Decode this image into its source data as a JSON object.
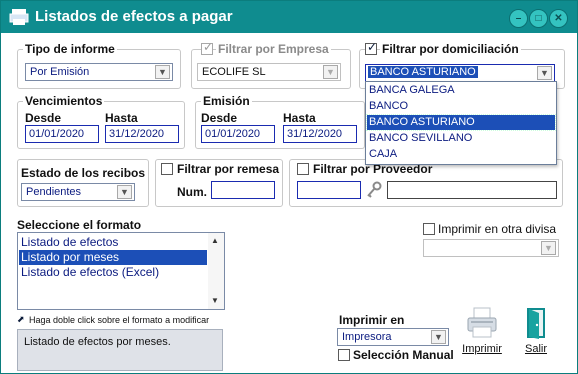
{
  "window": {
    "title": "Listados de efectos a pagar",
    "controls": [
      "minimize",
      "maximize",
      "close"
    ]
  },
  "tipo_informe": {
    "label": "Tipo de informe",
    "value": "Por Emisión"
  },
  "filtrar_empresa": {
    "label": "Filtrar por Empresa",
    "checked": true,
    "enabled": false,
    "value": "ECOLIFE SL"
  },
  "filtrar_domiciliacion": {
    "label": "Filtrar por domiciliación",
    "checked": true,
    "value": "BANCO ASTURIANO",
    "options": [
      "BANCA GALEGA",
      "BANCO",
      "BANCO ASTURIANO",
      "BANCO SEVILLANO",
      "CAJA"
    ],
    "selected_index": 2
  },
  "vencimientos": {
    "label": "Vencimientos",
    "desde_label": "Desde",
    "hasta_label": "Hasta",
    "desde": "01/01/2020",
    "hasta": "31/12/2020"
  },
  "emision": {
    "label": "Emisión",
    "desde_label": "Desde",
    "hasta_label": "Hasta",
    "desde": "01/01/2020",
    "hasta": "31/12/2020"
  },
  "estado_recibos": {
    "label": "Estado de los recibos",
    "value": "Pendientes"
  },
  "filtrar_remesa": {
    "label": "Filtrar por remesa",
    "num_label": "Num.",
    "checked": false,
    "value": ""
  },
  "filtrar_proveedor": {
    "label": "Filtrar por Proveedor",
    "checked": false,
    "code": "",
    "name": ""
  },
  "formato": {
    "label": "Seleccione el formato",
    "items": [
      "Listado de efectos",
      "Listado por meses",
      "Listado de efectos (Excel)"
    ],
    "selected_index": 1,
    "hint": "Haga doble click sobre el formato a modificar",
    "description": "Listado de efectos por meses."
  },
  "otra_divisa": {
    "label": "Imprimir en otra divisa",
    "checked": false,
    "value": ""
  },
  "imprimir_en": {
    "label": "Imprimir en",
    "value": "Impresora",
    "seleccion_manual_label": "Selección Manual",
    "seleccion_manual_checked": false
  },
  "actions": {
    "imprimir_label": "Imprimir",
    "salir_label": "Salir"
  },
  "colors": {
    "titlebar": "#0f8c8f",
    "selection": "#1c4fb7",
    "field_text": "#0b1b80"
  }
}
